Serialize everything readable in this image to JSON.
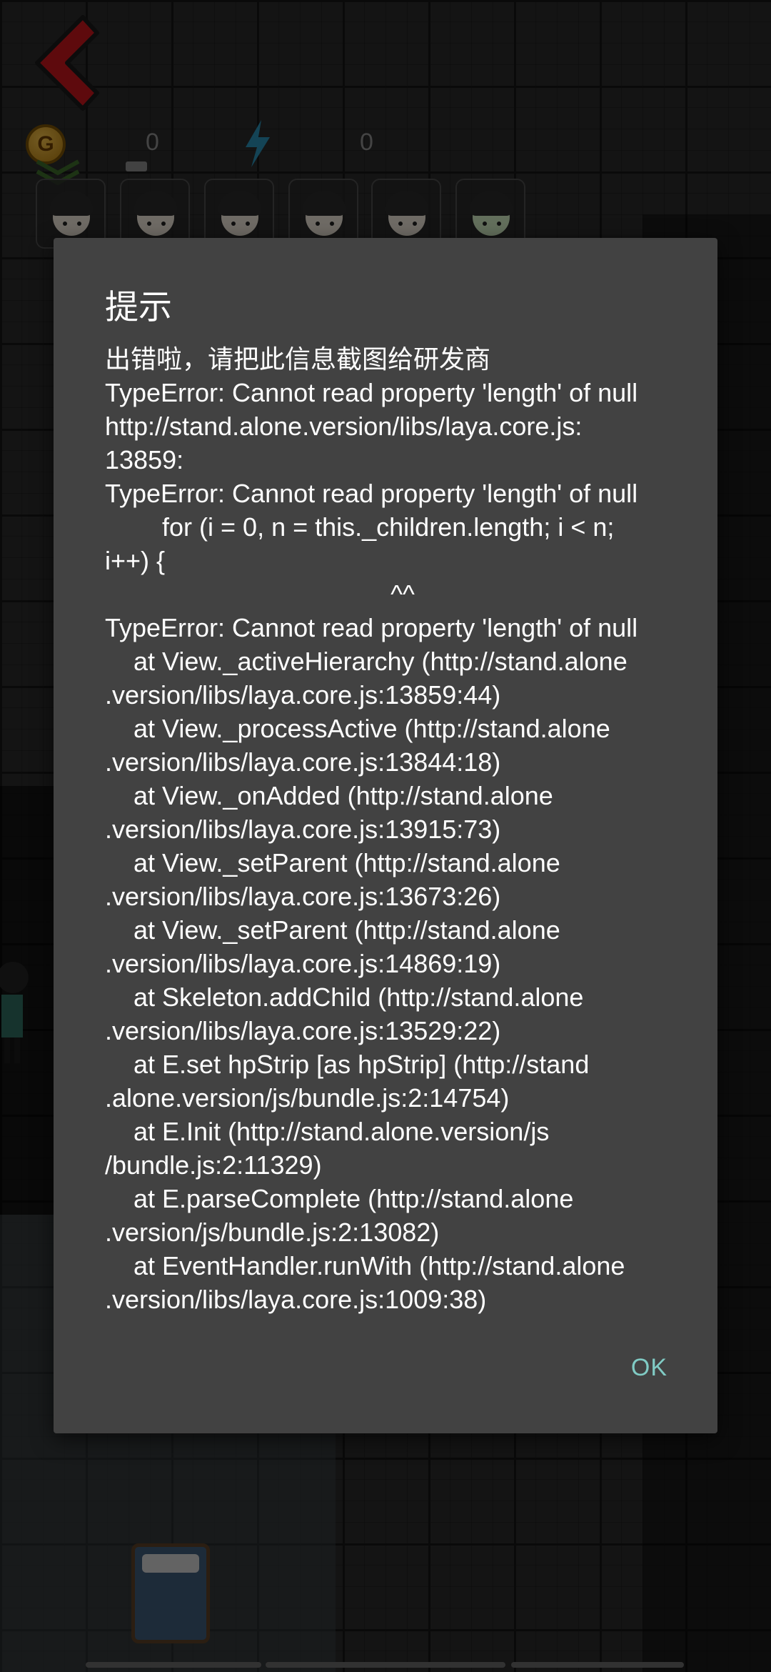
{
  "hud": {
    "coin_symbol": "G",
    "coin_count": "0",
    "energy_count": "0",
    "hero_slots": [
      "hero-1",
      "hero-2",
      "hero-3",
      "hero-4",
      "hero-5",
      "hero-6"
    ]
  },
  "dialog": {
    "title": "提示",
    "message_lines": [
      "出错啦，请把此信息截图给研发商",
      "TypeError: Cannot read property 'length' of null",
      "http://stand.alone.version/libs/laya.core.js:",
      "13859:",
      "TypeError: Cannot read property 'length' of null",
      "        for (i = 0, n = this._children.length; i < n;",
      "i++) {",
      "                                        ^^",
      "TypeError: Cannot read property 'length' of null",
      "    at View._activeHierarchy (http://stand.alone",
      ".version/libs/laya.core.js:13859:44)",
      "    at View._processActive (http://stand.alone",
      ".version/libs/laya.core.js:13844:18)",
      "    at View._onAdded (http://stand.alone",
      ".version/libs/laya.core.js:13915:73)",
      "    at View._setParent (http://stand.alone",
      ".version/libs/laya.core.js:13673:26)",
      "    at View._setParent (http://stand.alone",
      ".version/libs/laya.core.js:14869:19)",
      "    at Skeleton.addChild (http://stand.alone",
      ".version/libs/laya.core.js:13529:22)",
      "    at E.set hpStrip [as hpStrip] (http://stand",
      ".alone.version/js/bundle.js:2:14754)",
      "    at E.Init (http://stand.alone.version/js",
      "/bundle.js:2:11329)",
      "    at E.parseComplete (http://stand.alone",
      ".version/js/bundle.js:2:13082)",
      "    at EventHandler.runWith (http://stand.alone",
      ".version/libs/laya.core.js:1009:38)"
    ],
    "ok_label": "OK"
  },
  "colors": {
    "dialog_bg": "#424242",
    "accent": "#80cbc4",
    "back_arrow": "#c4151c"
  },
  "icons": {
    "back": "back-arrow-icon",
    "coin": "coin-icon",
    "energy": "lightning-icon",
    "key": "key-icon"
  }
}
